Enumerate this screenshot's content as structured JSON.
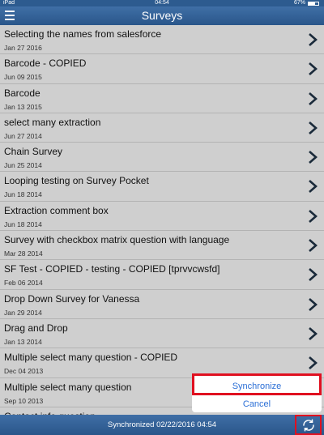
{
  "status": {
    "device": "iPad",
    "time": "04:54",
    "battery": "67%"
  },
  "header": {
    "title": "Surveys",
    "menu_icon": "hamburger-icon"
  },
  "surveys": [
    {
      "name": "Selecting the names from salesforce",
      "date": "Jan 27 2016"
    },
    {
      "name": "Barcode - COPIED",
      "date": "Jun 09 2015"
    },
    {
      "name": "Barcode",
      "date": "Jan 13 2015"
    },
    {
      "name": "select many extraction",
      "date": "Jun 27 2014"
    },
    {
      "name": "Chain Survey",
      "date": "Jun 25 2014"
    },
    {
      "name": "Looping testing on Survey Pocket",
      "date": "Jun 18 2014"
    },
    {
      "name": "Extraction comment box",
      "date": "Jun 18 2014"
    },
    {
      "name": "Survey with checkbox matrix question with language",
      "date": "Mar 28 2014"
    },
    {
      "name": "SF Test - COPIED - testing - COPIED [tprvvcwsfd]",
      "date": "Feb 06 2014"
    },
    {
      "name": "Drop Down Survey for Vanessa",
      "date": "Jan 29 2014"
    },
    {
      "name": "Drag and Drop",
      "date": "Jan 13 2014"
    },
    {
      "name": "Multiple select many question  - COPIED",
      "date": "Dec 04 2013"
    },
    {
      "name": "Multiple select many question",
      "date": "Sep 10 2013"
    },
    {
      "name": "Contact info question",
      "date": ""
    }
  ],
  "footer": {
    "sync_text": "Synchronized 02/22/2016 04:54",
    "refresh_icon": "refresh-icon"
  },
  "popup": {
    "synchronize": "Synchronize",
    "cancel": "Cancel"
  },
  "colors": {
    "bar": "#2d5b8f",
    "list_bg": "#cfcfcf",
    "highlight": "#e01020",
    "link": "#2b6fd6"
  }
}
